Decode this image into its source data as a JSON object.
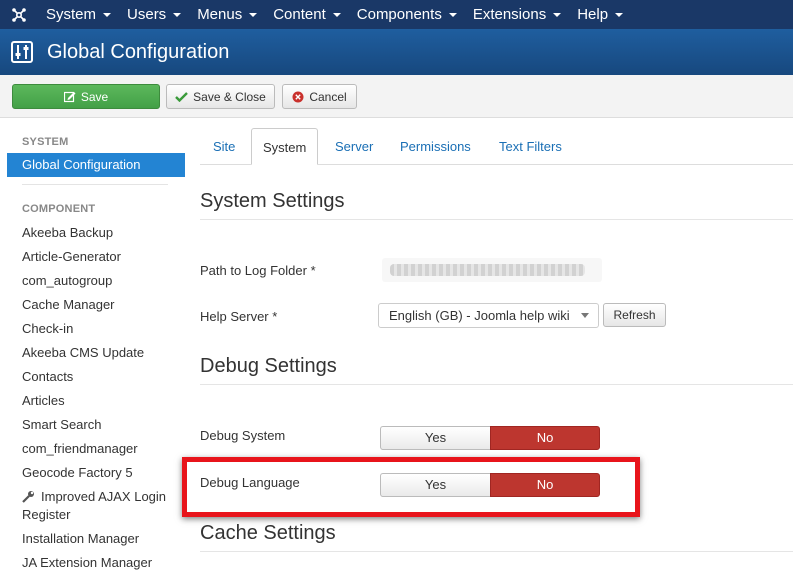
{
  "navbar": {
    "items": [
      {
        "label": "System"
      },
      {
        "label": "Users"
      },
      {
        "label": "Menus"
      },
      {
        "label": "Content"
      },
      {
        "label": "Components"
      },
      {
        "label": "Extensions"
      },
      {
        "label": "Help"
      }
    ]
  },
  "header": {
    "title": "Global Configuration",
    "icon": "sliders-icon"
  },
  "toolbar": {
    "save_label": "Save",
    "save_close_label": "Save & Close",
    "cancel_label": "Cancel"
  },
  "sidebar": {
    "system_heading": "SYSTEM",
    "active_item": "Global Configuration",
    "component_heading": "COMPONENT",
    "items": [
      {
        "label": "Akeeba Backup"
      },
      {
        "label": "Article-Generator"
      },
      {
        "label": "com_autogroup"
      },
      {
        "label": "Cache Manager"
      },
      {
        "label": "Check-in"
      },
      {
        "label": "Akeeba CMS Update"
      },
      {
        "label": "Contacts"
      },
      {
        "label": "Articles"
      },
      {
        "label": "Smart Search"
      },
      {
        "label": "com_friendmanager"
      },
      {
        "label": "Geocode Factory 5"
      },
      {
        "label": "Improved AJAX Login"
      },
      {
        "label": "Register"
      },
      {
        "label": "Installation Manager"
      },
      {
        "label": "JA Extension Manager"
      }
    ]
  },
  "tabs": [
    {
      "label": "Site"
    },
    {
      "label": "System"
    },
    {
      "label": "Server"
    },
    {
      "label": "Permissions"
    },
    {
      "label": "Text Filters"
    }
  ],
  "system_settings": {
    "title": "System Settings",
    "log_folder_label": "Path to Log Folder *",
    "help_server_label": "Help Server *",
    "help_server_value": "English (GB) - Joomla help wiki",
    "refresh_label": "Refresh"
  },
  "debug_settings": {
    "title": "Debug Settings",
    "debug_system_label": "Debug System",
    "debug_language_label": "Debug Language",
    "yes_label": "Yes",
    "no_label": "No"
  },
  "cache_settings": {
    "title": "Cache Settings"
  },
  "colors": {
    "navbar": "#1a3867",
    "header": "#1e5a96",
    "active_sidebar": "#2384d3",
    "no_active": "#bd362f",
    "highlight": "#e8141b",
    "save_button": "#5cb85c"
  }
}
